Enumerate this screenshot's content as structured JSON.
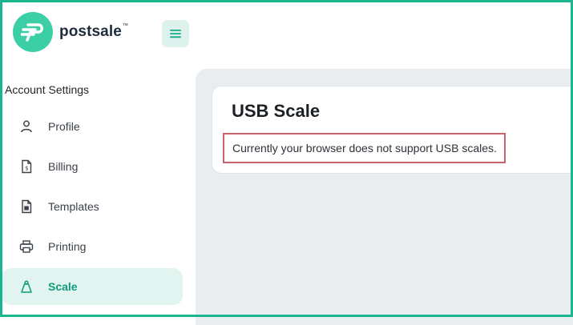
{
  "brand": {
    "name": "postsale",
    "trademark": "™",
    "color": "#3ccfa5"
  },
  "header": {
    "menu_icon": "hamburger-icon"
  },
  "sidebar": {
    "section_title": "Account Settings",
    "items": [
      {
        "label": "Profile",
        "icon": "user-icon",
        "active": false
      },
      {
        "label": "Billing",
        "icon": "invoice-icon",
        "active": false
      },
      {
        "label": "Templates",
        "icon": "document-icon",
        "active": false
      },
      {
        "label": "Printing",
        "icon": "printer-icon",
        "active": false
      },
      {
        "label": "Scale",
        "icon": "scale-icon",
        "active": true
      }
    ]
  },
  "main": {
    "title": "USB Scale",
    "message": "Currently your browser does not support USB scales."
  },
  "colors": {
    "accent": "#1bb58f",
    "active_bg": "#e2f4f0",
    "notice_border": "#c9636f",
    "content_bg": "#e9edf0"
  }
}
